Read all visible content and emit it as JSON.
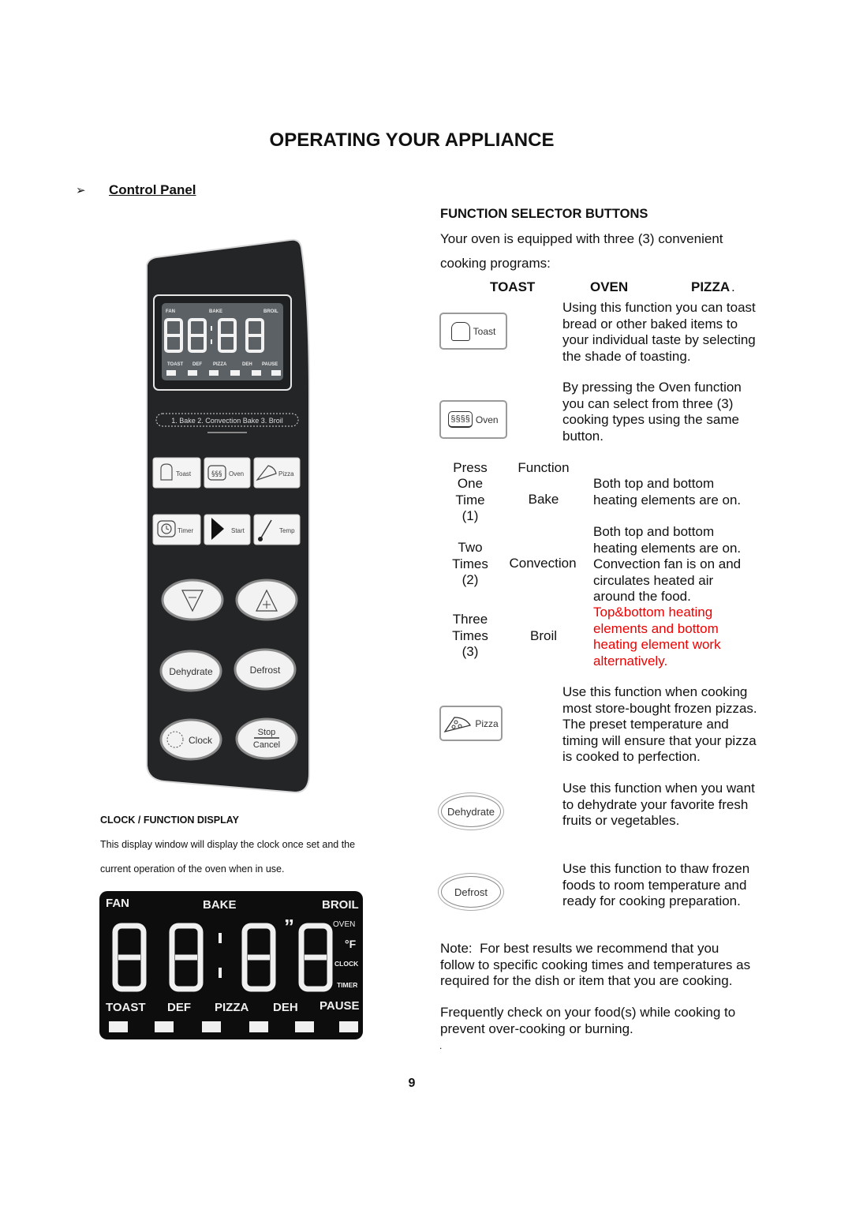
{
  "page": {
    "title": "OPERATING YOUR APPLIANCE",
    "page_number": "9",
    "trailing_mark": "."
  },
  "control_panel": {
    "bullet": "➢",
    "heading": "Control Panel",
    "panel_lcd": {
      "top_labels": [
        "FAN",
        "BAKE",
        "BROIL"
      ],
      "digits": "88:88",
      "side_labels": [
        "OVEN",
        "°F",
        "CLOCK",
        "TIMER"
      ],
      "bottom_labels": [
        "TOAST",
        "DEF",
        "PIZZA",
        "DEH",
        "PAUSE"
      ]
    },
    "oven_modes_strip": "1. Bake  2. Convection Bake  3. Broil",
    "square_buttons": [
      {
        "label": "Toast",
        "icon": "bread-icon"
      },
      {
        "label": "Oven",
        "icon": "heat-waves-icon"
      },
      {
        "label": "Pizza",
        "icon": "pizza-slice-icon"
      },
      {
        "label": "Timer",
        "icon": "clock-icon"
      },
      {
        "label": "Start",
        "icon": "play-icon"
      },
      {
        "label": "Temp",
        "icon": "thermometer-probe-icon"
      }
    ],
    "oval_buttons": [
      {
        "label": "−",
        "icon": "down-triangle-minus-icon"
      },
      {
        "label": "+",
        "icon": "up-triangle-plus-icon"
      },
      {
        "label": "Dehydrate"
      },
      {
        "label": "Defrost"
      },
      {
        "label": "Clock",
        "icon": "clock-dial-icon"
      },
      {
        "label_top": "Stop",
        "label_bottom": "Cancel"
      }
    ]
  },
  "clock_display": {
    "heading": "CLOCK / FUNCTION DISPLAY",
    "line1": "This display window will display the clock once set and the",
    "line2": "current operation of the oven when in use.",
    "lcd": {
      "top_labels": [
        "FAN",
        "BAKE",
        "BROIL"
      ],
      "side_labels": [
        "OVEN",
        "°F",
        "CLOCK",
        "TIMER"
      ],
      "bottom_labels": [
        "TOAST",
        "DEF",
        "PIZZA",
        "DEH",
        "PAUSE"
      ]
    }
  },
  "function_selector": {
    "heading": "FUNCTION SELECTOR BUTTONS",
    "intro_line1": "Your oven is equipped with three (3) convenient",
    "intro_line2": "cooking programs:",
    "programs": [
      "TOAST",
      "OVEN",
      "PIZZA"
    ],
    "programs_trailing": ".",
    "toast": {
      "button_label": "Toast",
      "lines": [
        "Using this function you can toast",
        "bread or other baked items to",
        "your individual taste by selecting",
        "the shade of toasting."
      ]
    },
    "oven": {
      "button_label": "Oven",
      "lines": [
        "By pressing the Oven function",
        "you can select from three (3)",
        "cooking types using the same",
        "button."
      ]
    },
    "oven_table": {
      "headers": [
        "Press",
        "Function"
      ],
      "rows": [
        {
          "press": [
            "One",
            "Time",
            "(1)"
          ],
          "function": "Bake",
          "desc": [
            "Both top and bottom",
            "heating elements are on."
          ],
          "desc_color": "#111111"
        },
        {
          "press": [
            "Two",
            "Times",
            "(2)"
          ],
          "function": "Convection",
          "desc": [
            "Both top and bottom",
            "heating elements are on.",
            "Convection fan is on and",
            "circulates heated air",
            "around the food."
          ],
          "desc_color": "#111111"
        },
        {
          "press": [
            "Three",
            "Times",
            "(3)"
          ],
          "function": "Broil",
          "desc": [
            "Top&bottom heating",
            "elements and bottom",
            "heating element work",
            "alternatively."
          ],
          "desc_color": "#ee0000"
        }
      ]
    },
    "pizza": {
      "button_label": "Pizza",
      "lines": [
        "Use this function when cooking",
        "most store-bought frozen pizzas.",
        "The preset temperature and",
        "timing will ensure that your pizza",
        "is cooked to perfection."
      ]
    },
    "dehydrate": {
      "button_label": "Dehydrate",
      "lines": [
        "Use this function when you want",
        "to dehydrate your favorite fresh",
        "fruits or vegetables."
      ]
    },
    "defrost": {
      "button_label": "Defrost",
      "lines": [
        "Use this function to thaw frozen",
        "foods to room temperature and",
        "ready for cooking preparation."
      ]
    },
    "note_lines": [
      "Note:  For best results we recommend that you",
      "follow to specific cooking times and temperatures as",
      "required for the dish or item that you are cooking."
    ],
    "check_lines": [
      "Frequently check on your food(s) while cooking to",
      "prevent over-cooking or burning."
    ]
  },
  "colors": {
    "panel_body": "#232526",
    "lcd_bg": "#5b6165",
    "big_lcd_bg": "#0d0d0d",
    "warning_text": "#ee0000"
  }
}
